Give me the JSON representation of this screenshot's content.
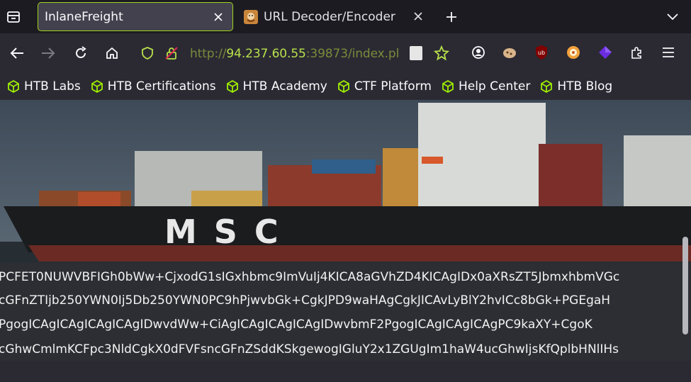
{
  "tabs": [
    {
      "title": "InlaneFreight",
      "active": true
    },
    {
      "title": "URL Decoder/Encoder",
      "active": false
    }
  ],
  "navbar": {
    "url_prefix": "http://",
    "url_host": "94.237.60.55",
    "url_rest": ":39873/index.pl"
  },
  "bookmarks": [
    {
      "label": "HTB Labs"
    },
    {
      "label": "HTB Certifications"
    },
    {
      "label": "HTB Academy"
    },
    {
      "label": "CTF Platform"
    },
    {
      "label": "Help Center"
    },
    {
      "label": "HTB Blog"
    }
  ],
  "page": {
    "hero_text": "MSC",
    "encoded_lines": [
      "PCFET0NUWVBFIGh0bWw+CjxodG1sIGxhbmc9ImVuIj4KICA8aGVhZD4KICAgIDx0aXRsZT5JbmxhbmVGc",
      "cGFnZTIjb250YWN0Ij5Db250YWN0PC9hPjwvbGk+CgkJPD9waHAgCgkJICAvLyBlY2hvICc8bGk+PGEgaH",
      "PgogICAgICAgICAgICAgIDwvdWw+CiAgICAgICAgICAgIDwvbmF2PgogICAgICAgICAgPC9kaXY+CgoK",
      "cGhwCmlmKCFpc3NldCgkX0dFVFsncGFnZSddKSkgewogIGluY2x1ZGUgIm1haW4ucGhwIjsKfQplbHNlIHs"
    ]
  },
  "colors": {
    "accent": "#a3d41d",
    "tabstrip": "#1c1b22",
    "toolbar": "#2b2a33",
    "url_host": "#b8e14a"
  }
}
